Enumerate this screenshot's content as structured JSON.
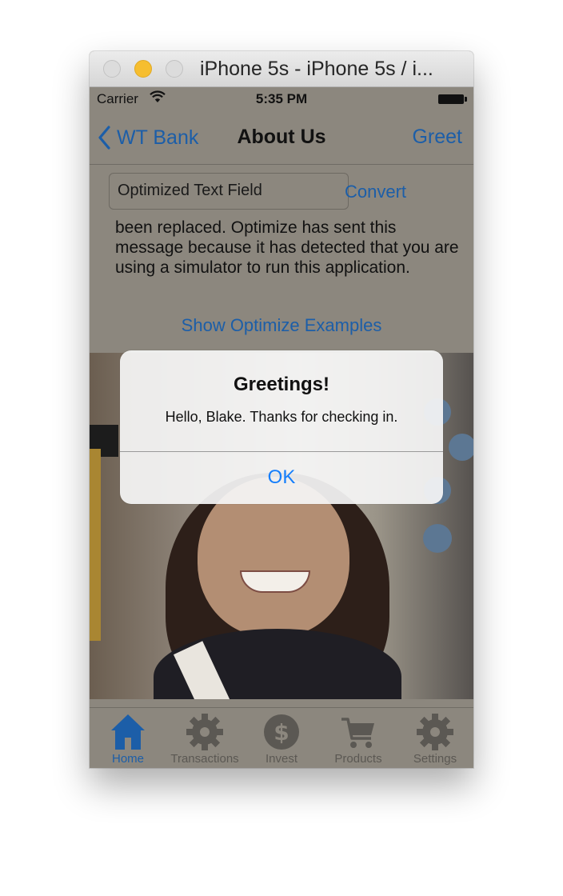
{
  "window": {
    "title": "iPhone 5s - iPhone 5s / i..."
  },
  "status_bar": {
    "carrier": "Carrier",
    "time": "5:35 PM"
  },
  "nav_bar": {
    "back_label": "WT Bank",
    "title": "About Us",
    "right_button": "Greet"
  },
  "content": {
    "text_field_value": "Optimized Text Field",
    "convert_label": "Convert",
    "message": "been replaced. Optimize has sent this message because it has detected that you are using a simulator to run this application.",
    "examples_link": "Show Optimize Examples"
  },
  "alert": {
    "title": "Greetings!",
    "message": "Hello, Blake. Thanks for checking in.",
    "ok_label": "OK"
  },
  "tab_bar": {
    "tabs": [
      {
        "label": "Home",
        "icon": "home-icon",
        "active": true
      },
      {
        "label": "Transactions",
        "icon": "gear-icon",
        "active": false
      },
      {
        "label": "Invest",
        "icon": "dollar-icon",
        "active": false
      },
      {
        "label": "Products",
        "icon": "cart-icon",
        "active": false
      },
      {
        "label": "Settings",
        "icon": "gear-icon",
        "active": false
      }
    ]
  },
  "colors": {
    "tint": "#1c5ea8",
    "alert_button": "#157efb",
    "dimmed_background": "#8c877e"
  }
}
